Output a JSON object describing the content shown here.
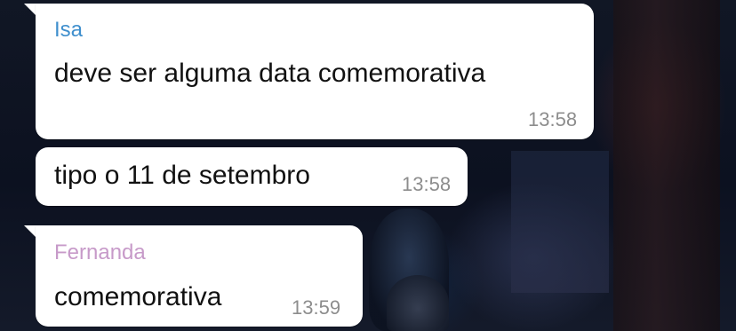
{
  "messages": [
    {
      "sender": "Isa",
      "text": "deve ser alguma data comemorativa",
      "time": "13:58"
    },
    {
      "sender": "",
      "text": "tipo o 11 de setembro",
      "time": "13:58"
    },
    {
      "sender": "Fernanda",
      "text": "comemorativa",
      "time": "13:59"
    }
  ],
  "colors": {
    "sender_isa": "#3f8fcd",
    "sender_fernanda": "#c79ac9",
    "bubble": "#ffffff",
    "timestamp": "#8d8d8d"
  }
}
